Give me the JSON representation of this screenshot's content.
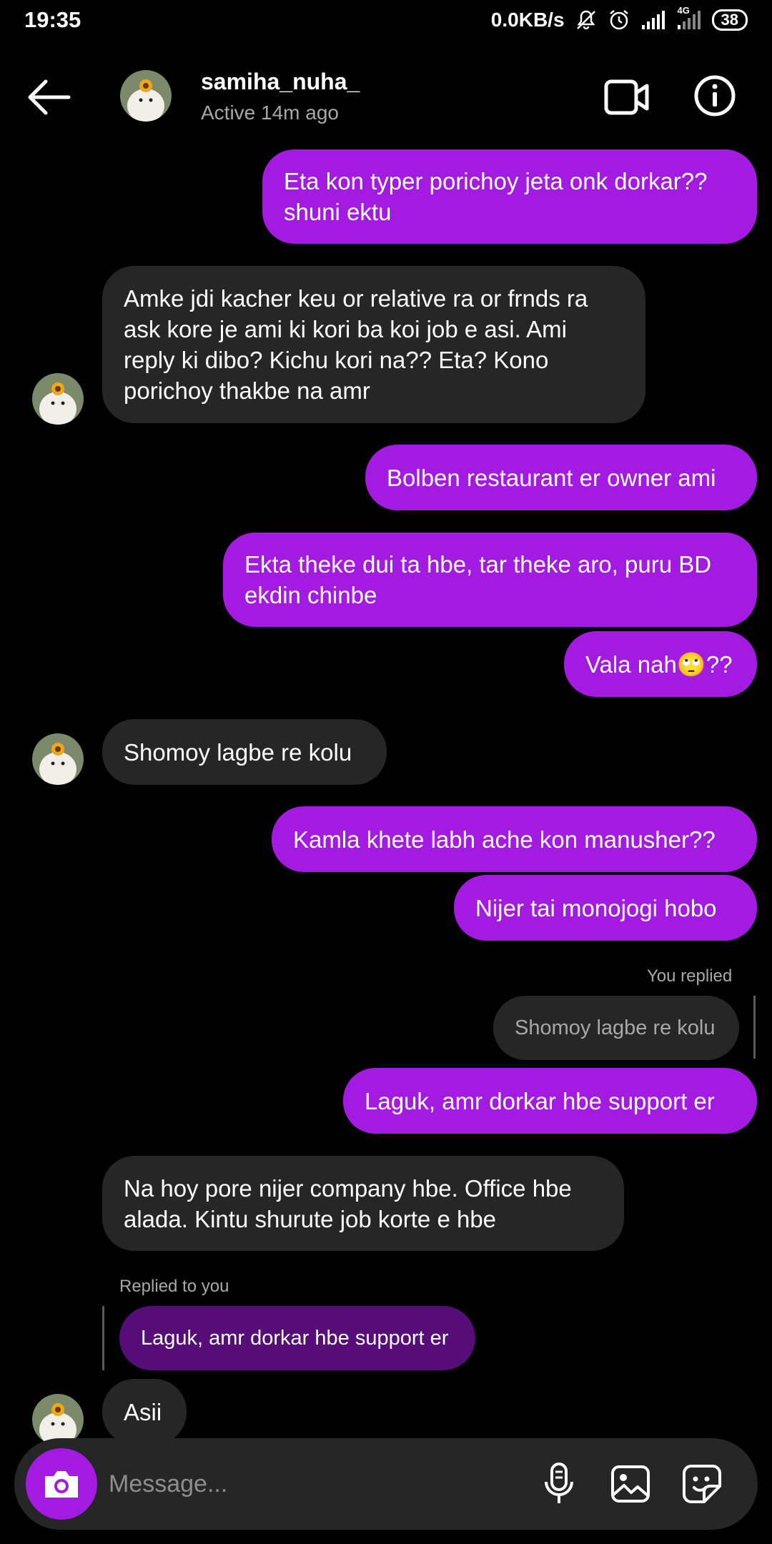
{
  "status_bar": {
    "time": "19:35",
    "network_speed": "0.0KB/s",
    "network_type": "4G",
    "battery": "38"
  },
  "header": {
    "username": "samiha_nuha_",
    "active_status": "Active 14m ago"
  },
  "messages": [
    {
      "from": "me",
      "text": "Eta kon typer porichoy jeta onk dorkar?? shuni ektu"
    },
    {
      "from": "them",
      "text": "Amke jdi kacher keu or relative ra or frnds ra ask kore je ami ki kori ba koi job e asi. Ami reply ki dibo? Kichu kori na?? Eta? Kono porichoy thakbe na amr"
    },
    {
      "from": "me",
      "text": "Bolben restaurant er owner ami"
    },
    {
      "from": "me",
      "text": "Ekta theke dui ta hbe, tar theke aro, puru BD ekdin chinbe"
    },
    {
      "from": "me",
      "text": "Vala nah🙄??"
    },
    {
      "from": "them",
      "text": "Shomoy lagbe re kolu"
    },
    {
      "from": "me",
      "text": "Kamla khete labh ache kon manusher??"
    },
    {
      "from": "me",
      "text": "Nijer tai monojogi hobo"
    },
    {
      "from": "me",
      "reply_label": "You replied",
      "quoted_text": "Shomoy lagbe re kolu",
      "text": "Laguk, amr dorkar hbe support er"
    },
    {
      "from": "them",
      "text": "Na hoy pore nijer company hbe. Office hbe alada. Kintu shurute job korte e hbe"
    },
    {
      "from": "them",
      "reply_label": "Replied to you",
      "quoted_text": "Laguk, amr dorkar hbe support er",
      "text": "Asii"
    }
  ],
  "composer": {
    "placeholder": "Message..."
  },
  "colors": {
    "outgoing_bubble": "#a31be0",
    "incoming_bubble": "#262626",
    "quoted_outgoing": "#560d78",
    "background": "#000000"
  },
  "icons": [
    "back-arrow-icon",
    "video-call-icon",
    "info-icon",
    "camera-icon",
    "microphone-icon",
    "gallery-icon",
    "sticker-icon",
    "mute-icon",
    "alarm-icon",
    "signal-icon"
  ]
}
